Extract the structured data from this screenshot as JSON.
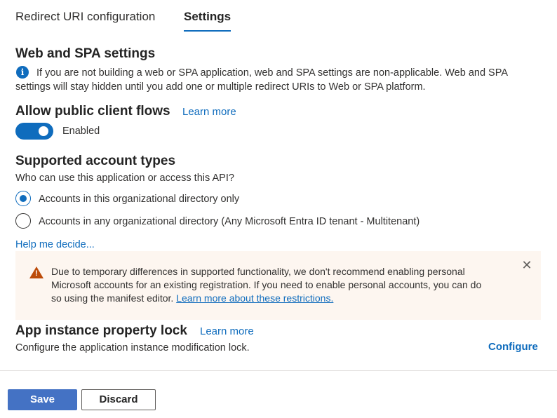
{
  "tabs": [
    {
      "label": "Redirect URI configuration",
      "active": false
    },
    {
      "label": "Settings",
      "active": true
    }
  ],
  "web_spa": {
    "title": "Web and SPA settings",
    "info_line1": "If you are not building a web or SPA application, web and SPA settings are non-applicable. Web and SPA",
    "info_line2": "settings will stay hidden until you add one or multiple redirect URIs to Web or SPA platform."
  },
  "public_client": {
    "title": "Allow public client flows",
    "learn_more": "Learn more",
    "toggle_on": true,
    "toggle_label": "Enabled"
  },
  "account_types": {
    "title": "Supported account types",
    "question": "Who can use this application or access this API?",
    "options": [
      {
        "label": "Accounts in this organizational directory only",
        "selected": true
      },
      {
        "label": "Accounts in any organizational directory (Any Microsoft Entra ID tenant - Multitenant)",
        "selected": false
      }
    ],
    "help": "Help me decide..."
  },
  "warning": {
    "line1": "Due to temporary differences in supported functionality, we don't recommend enabling personal",
    "line2": "Microsoft accounts for an existing registration. If you need to enable personal accounts, you can do",
    "line3_prefix": "so using the manifest editor. ",
    "link": "Learn more about these restrictions."
  },
  "lock": {
    "title": "App instance property lock",
    "learn_more": "Learn more",
    "description": "Configure the application instance modification lock.",
    "configure": "Configure"
  },
  "footer": {
    "save": "Save",
    "discard": "Discard"
  },
  "colors": {
    "accent": "#0f6cbd",
    "save_button": "#4472c4",
    "warning_bg": "#fdf6f0",
    "warning_icon": "#bc4b09"
  }
}
